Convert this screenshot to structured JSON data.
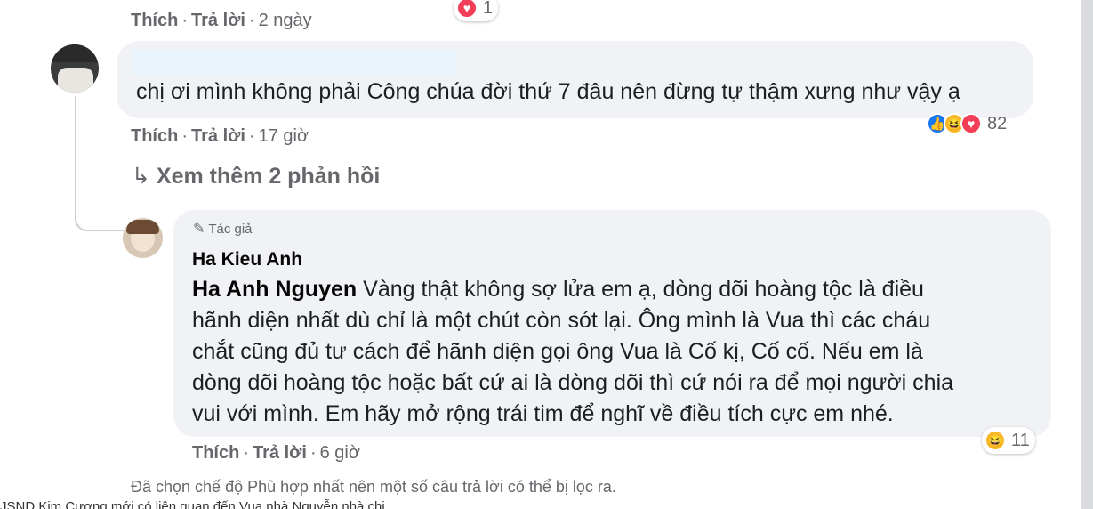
{
  "top_comment": {
    "actions": {
      "like": "Thích",
      "reply": "Trả lời",
      "time": "2 ngày"
    },
    "reaction_count": "1"
  },
  "comment1": {
    "text": "chị ơi mình không phải Công chúa đời thứ 7 đâu nên đừng tự thậm xưng như vậy ạ",
    "actions": {
      "like": "Thích",
      "reply": "Trả lời",
      "time": "17 giờ"
    },
    "reaction_count": "82",
    "more_replies": "Xem thêm 2 phản hồi"
  },
  "reply": {
    "author_badge": "Tác giả",
    "author": "Ha Kieu Anh",
    "mention": "Ha Anh Nguyen",
    "text_lines": [
      " Vàng thật không sợ lửa em ạ, dòng dõi hoàng tộc là điều",
      "hãnh diện nhất dù chỉ là một chút còn sót lại. Ông mình là Vua thì các cháu",
      "chắt cũng đủ tư cách để hãnh diện gọi ông Vua là Cố kị, Cố cố. Nếu em là",
      "dòng dõi hoàng tộc hoặc bất cứ ai là dòng dõi thì cứ nói ra để mọi người chia",
      "vui với mình. Em hãy mở rộng trái tim để nghĩ về điều tích cực em nhé."
    ],
    "actions": {
      "like": "Thích",
      "reply": "Trả lời",
      "time": "6 giờ"
    },
    "reaction_count": "11"
  },
  "filter_notice": "Đã chọn chế độ Phù hợp nhất nên một số câu trả lời có thể bị lọc ra.",
  "caption_fragment": "JSND Kim Cương mới có liên quan đến Vua nhà Nguyễn nhà chị"
}
